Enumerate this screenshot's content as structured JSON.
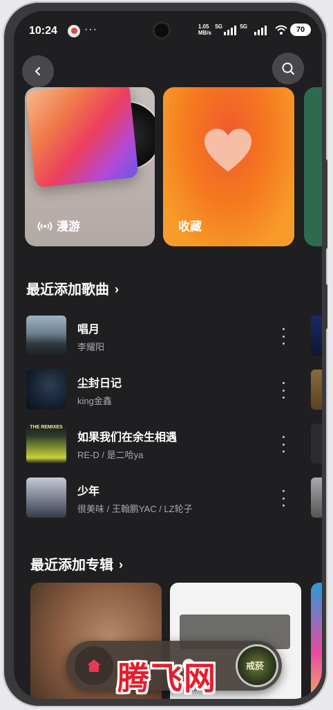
{
  "status_bar": {
    "time": "10:24",
    "more": "···",
    "net_speed_value": "1.05",
    "net_speed_unit": "MB/s",
    "sim1": "5G",
    "sim2": "5G",
    "battery": "70"
  },
  "cards": [
    {
      "label": "漫游",
      "icon": "radio-waves-icon"
    },
    {
      "label": "收藏",
      "icon": "heart-icon"
    }
  ],
  "recent_songs": {
    "title": "最近添加歌曲",
    "chevron": "›",
    "items": [
      {
        "title": "唱月",
        "artist": "李耀阳"
      },
      {
        "title": "尘封日记",
        "artist": "king金鑫"
      },
      {
        "title": "如果我们在余生相遇",
        "artist": "RE-D / 是二哈ya"
      },
      {
        "title": "少年",
        "artist": "很美味 / 王翰鹏YAC / LZ轮子"
      }
    ]
  },
  "recent_albums": {
    "title": "最近添加专辑",
    "chevron": "›"
  },
  "album_cover_text": "THE REMIXES",
  "player": {
    "disc_text": "戒菸"
  },
  "watermark": "腾飞网"
}
